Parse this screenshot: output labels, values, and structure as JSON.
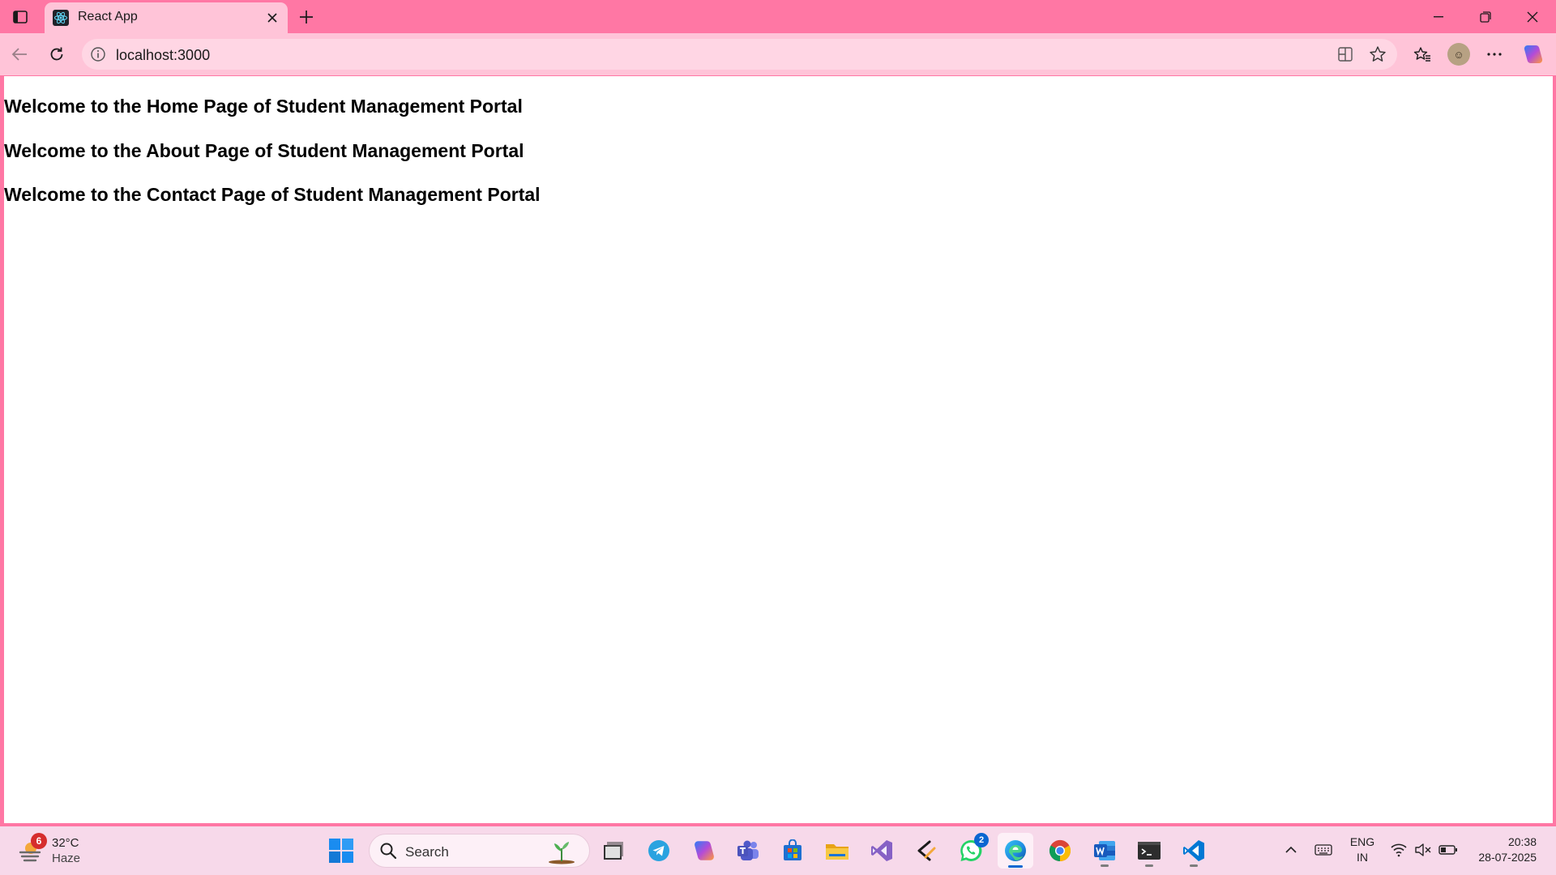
{
  "browser": {
    "tab_title": "React App",
    "url": "localhost:3000"
  },
  "page": {
    "headings": [
      "Welcome to the Home Page of Student Management Portal",
      "Welcome to the About Page of Student Management Portal",
      "Welcome to the Contact Page of Student Management Portal"
    ]
  },
  "taskbar": {
    "weather": {
      "temperature": "32°C",
      "condition": "Haze",
      "badge": "6"
    },
    "search_label": "Search",
    "whatsapp_badge": "2",
    "language": {
      "line1": "ENG",
      "line2": "IN"
    },
    "clock": {
      "time": "20:38",
      "date": "28-07-2025"
    }
  },
  "colors": {
    "frame": "#ff77a4",
    "toolbar": "#ffc4d8",
    "page_background": "#ffffff",
    "taskbar": "#f7d9ea"
  },
  "icons": [
    "sidebar-toggle-icon",
    "react-favicon-icon",
    "close-icon",
    "plus-icon",
    "minimize-icon",
    "restore-icon",
    "back-arrow-icon",
    "refresh-icon",
    "info-icon",
    "split-screen-icon",
    "star-icon",
    "favorites-icon",
    "more-icon",
    "copilot-icon",
    "windows-start-icon",
    "search-icon",
    "file-manager-icon",
    "telegram-icon",
    "copilot-app-icon",
    "teams-icon",
    "store-icon",
    "folder-icon",
    "visual-studio-icon",
    "code-tool-icon",
    "whatsapp-icon",
    "edge-icon",
    "chrome-icon",
    "word-icon",
    "terminal-icon",
    "vscode-icon",
    "chevron-up-icon",
    "keyboard-icon",
    "wifi-icon",
    "volume-muted-icon",
    "battery-icon"
  ]
}
